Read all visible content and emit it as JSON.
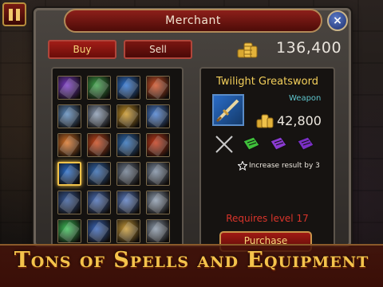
{
  "header": {
    "title": "Merchant",
    "close_label": "×",
    "tabs": [
      {
        "label": "Buy",
        "active": true
      },
      {
        "label": "Sell",
        "active": false
      }
    ],
    "gold_amount": "136,400"
  },
  "grid": {
    "items": [
      {
        "name": "purple-scroll",
        "color": "#7a3bc4"
      },
      {
        "name": "green-wand",
        "color": "#3fa14a"
      },
      {
        "name": "blue-potion",
        "color": "#2f74d0"
      },
      {
        "name": "fire-sword",
        "color": "#d0532a"
      },
      {
        "name": "crossed-blades",
        "color": "#5d8bbd"
      },
      {
        "name": "spiked-shield",
        "color": "#8a9bb3"
      },
      {
        "name": "golden-hammer",
        "color": "#c9962a"
      },
      {
        "name": "ice-blades",
        "color": "#4a7fd0"
      },
      {
        "name": "flame-wings",
        "color": "#d9752a"
      },
      {
        "name": "flame-sword",
        "color": "#c94a1e"
      },
      {
        "name": "ice-dagger",
        "color": "#2f6fb8"
      },
      {
        "name": "fire-dagger",
        "color": "#c33c1c"
      },
      {
        "name": "twilight-greatsword",
        "color": "#2a6cc7",
        "selected": true
      },
      {
        "name": "blue-axe",
        "color": "#3469b0"
      },
      {
        "name": "steel-armor",
        "color": "#6f7d90"
      },
      {
        "name": "knight-armor",
        "color": "#7e8ea3"
      },
      {
        "name": "dragon-helm",
        "color": "#3a5c9a"
      },
      {
        "name": "frost-gauntlet",
        "color": "#4b6fb6"
      },
      {
        "name": "ice-gauntlet",
        "color": "#5a7cc0"
      },
      {
        "name": "silver-chestplate",
        "color": "#8e9db0"
      },
      {
        "name": "emerald-gem",
        "color": "#3fbf5a"
      },
      {
        "name": "blue-helm",
        "color": "#3a66b8"
      },
      {
        "name": "gold-shield",
        "color": "#c89b3a"
      },
      {
        "name": "silver-helm",
        "color": "#8c9aab"
      }
    ]
  },
  "details": {
    "name": "Twilight Greatsword",
    "type": "Weapon",
    "price": "42,800",
    "ingredients": [
      {
        "name": "crossed-swords",
        "color": "#c9c9c9"
      },
      {
        "name": "green-book",
        "color": "#3fbf3a"
      },
      {
        "name": "purple-book",
        "color": "#8a3ad0"
      },
      {
        "name": "purple-book-2",
        "color": "#7a2fc4"
      }
    ],
    "bonus": "Increase result by 3",
    "requirement": "Requires level 17",
    "purchase_label": "Purchase"
  },
  "banner": {
    "text": "Tons of Spells and Equipment"
  },
  "colors": {
    "accent_gold": "#f3cf5a",
    "title_red": "#8d1f1a",
    "requires_red": "#d9342a",
    "weapon_cyan": "#5ec4cc"
  }
}
